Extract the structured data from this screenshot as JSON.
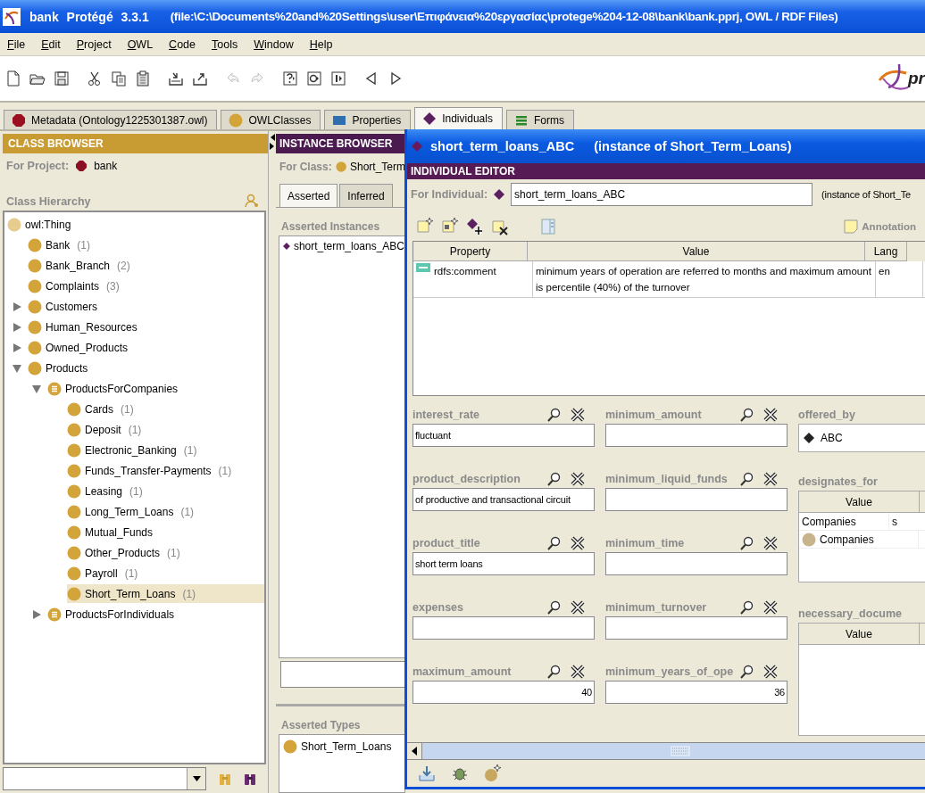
{
  "window": {
    "app": "bank Protégé 3.3.1",
    "file": "(file:\\C:\\Documents%20and%20Settings\\user\\Επιφάνεια%20εργασίας\\protege%204-12-08\\bank\\bank.pprj, OWL / RDF Files)"
  },
  "menu": [
    "File",
    "Edit",
    "Project",
    "OWL",
    "Code",
    "Tools",
    "Window",
    "Help"
  ],
  "toolbar": [
    {
      "kind": "new",
      "disabled": false
    },
    {
      "kind": "open",
      "disabled": false
    },
    {
      "kind": "save",
      "disabled": false
    },
    {
      "kind": "cut",
      "disabled": false
    },
    {
      "kind": "copy",
      "disabled": false
    },
    {
      "kind": "paste",
      "disabled": false
    },
    {
      "kind": "import",
      "disabled": false
    },
    {
      "kind": "export",
      "disabled": false
    },
    {
      "kind": "undo",
      "disabled": true
    },
    {
      "kind": "redo",
      "disabled": true
    },
    {
      "kind": "query",
      "disabled": false
    },
    {
      "kind": "class-nav",
      "disabled": false
    },
    {
      "kind": "instance-nav",
      "disabled": false
    },
    {
      "kind": "back",
      "disabled": false
    },
    {
      "kind": "forward",
      "disabled": false
    }
  ],
  "logo": {
    "text": "pr"
  },
  "tabs": [
    {
      "label": "Metadata (Ontology1225301387.owl)",
      "kind": "metadata",
      "selected": false
    },
    {
      "label": "OWLClasses",
      "kind": "classes",
      "selected": false
    },
    {
      "label": "Properties",
      "kind": "properties",
      "selected": false
    },
    {
      "label": "Individuals",
      "kind": "individuals",
      "selected": true
    },
    {
      "label": "Forms",
      "kind": "forms",
      "selected": false
    }
  ],
  "class_browser": {
    "header": "CLASS BROWSER",
    "project_label": "For Project:",
    "project": "bank",
    "hierarchy_label": "Class Hierarchy",
    "tree": [
      {
        "label": "owl:Thing",
        "kind": "root",
        "selected": false,
        "children": [
          {
            "label": "Bank",
            "count": "(1)",
            "kind": "class",
            "selected": false
          },
          {
            "label": "Bank_Branch",
            "count": "(2)",
            "kind": "class",
            "selected": false
          },
          {
            "label": "Complaints",
            "count": "(3)",
            "kind": "class",
            "selected": false
          },
          {
            "label": "Customers",
            "kind": "class",
            "expanded": false,
            "selected": false
          },
          {
            "label": "Human_Resources",
            "kind": "class",
            "expanded": false,
            "selected": false
          },
          {
            "label": "Owned_Products",
            "kind": "class",
            "expanded": false,
            "selected": false
          },
          {
            "label": "Products",
            "kind": "class",
            "expanded": true,
            "selected": false,
            "children": [
              {
                "label": "ProductsForCompanies",
                "kind": "defined",
                "expanded": true,
                "selected": false,
                "children": [
                  {
                    "label": "Cards",
                    "count": "(1)",
                    "kind": "class",
                    "selected": false
                  },
                  {
                    "label": "Deposit",
                    "count": "(1)",
                    "kind": "class",
                    "selected": false
                  },
                  {
                    "label": "Electronic_Banking",
                    "count": "(1)",
                    "kind": "class",
                    "selected": false
                  },
                  {
                    "label": "Funds_Transfer-Payments",
                    "count": "(1)",
                    "kind": "class",
                    "selected": false
                  },
                  {
                    "label": "Leasing",
                    "count": "(1)",
                    "kind": "class",
                    "selected": false
                  },
                  {
                    "label": "Long_Term_Loans",
                    "count": "(1)",
                    "kind": "class",
                    "selected": false
                  },
                  {
                    "label": "Mutual_Funds",
                    "kind": "class",
                    "selected": false
                  },
                  {
                    "label": "Other_Products",
                    "count": "(1)",
                    "kind": "class",
                    "selected": false
                  },
                  {
                    "label": "Payroll",
                    "count": "(1)",
                    "kind": "class",
                    "selected": false
                  },
                  {
                    "label": "Short_Term_Loans",
                    "count": "(1)",
                    "kind": "class",
                    "selected": true
                  }
                ]
              },
              {
                "label": "ProductsForIndividuals",
                "kind": "defined",
                "expanded": false,
                "selected": false
              }
            ]
          }
        ]
      }
    ]
  },
  "instance_browser": {
    "header": "INSTANCE BROWSER",
    "class_label": "For Class:",
    "class_name": "Short_Term",
    "tabs": [
      {
        "label": "Asserted",
        "selected": true
      },
      {
        "label": "Inferred",
        "selected": false
      }
    ],
    "instances_label": "Asserted Instances",
    "instances": [
      {
        "label": "short_term_loans_ABC",
        "selected": false
      }
    ],
    "types_label": "Asserted Types",
    "types": [
      "Short_Term_Loans"
    ]
  },
  "editor": {
    "title": "short_term_loans_ABC",
    "title_note": "(instance of Short_Term_Loans)",
    "header": "INDIVIDUAL EDITOR",
    "for_label": "For Individual:",
    "individual": "short_term_loans_ABC",
    "instance_note": "(instance of Short_Te",
    "annotations_label": "Annotation",
    "annotations": {
      "columns": [
        "Property",
        "Value",
        "Lang"
      ],
      "rows": [
        {
          "property": "rdfs:comment",
          "value": "minimum years of operation are referred to months and maximum amount is percentile (40%) of the turnover",
          "lang": "en"
        }
      ]
    },
    "fields": [
      [
        {
          "label": "interest_rate",
          "kind": "text",
          "value": "fluctuant"
        },
        {
          "label": "product_description",
          "kind": "text",
          "value": "of productive and transactional circuit"
        },
        {
          "label": "product_title",
          "kind": "text",
          "value": "short term loans"
        },
        {
          "label": "expenses",
          "kind": "text"
        },
        {
          "label": "maximum_amount",
          "kind": "number",
          "value": "40"
        }
      ],
      [
        {
          "label": "minimum_amount",
          "kind": "text"
        },
        {
          "label": "minimum_liquid_funds",
          "kind": "text"
        },
        {
          "label": "minimum_time",
          "kind": "text"
        },
        {
          "label": "minimum_turnover",
          "kind": "text"
        },
        {
          "label": "minimum_years_of_ope",
          "kind": "number",
          "value": "36"
        }
      ],
      [
        {
          "label": "offered_by",
          "kind": "instances",
          "items": [
            "ABC"
          ]
        },
        {
          "label": "designates_for",
          "kind": "table",
          "columns": [
            "Value"
          ],
          "rows": [
            {
              "kind": "text",
              "cells": [
                "Companies",
                "s"
              ]
            },
            {
              "kind": "class",
              "cells": [
                "Companies"
              ]
            }
          ]
        },
        {
          "label": "necessary_docume",
          "kind": "table",
          "columns": [
            "Value"
          ]
        }
      ]
    ]
  }
}
